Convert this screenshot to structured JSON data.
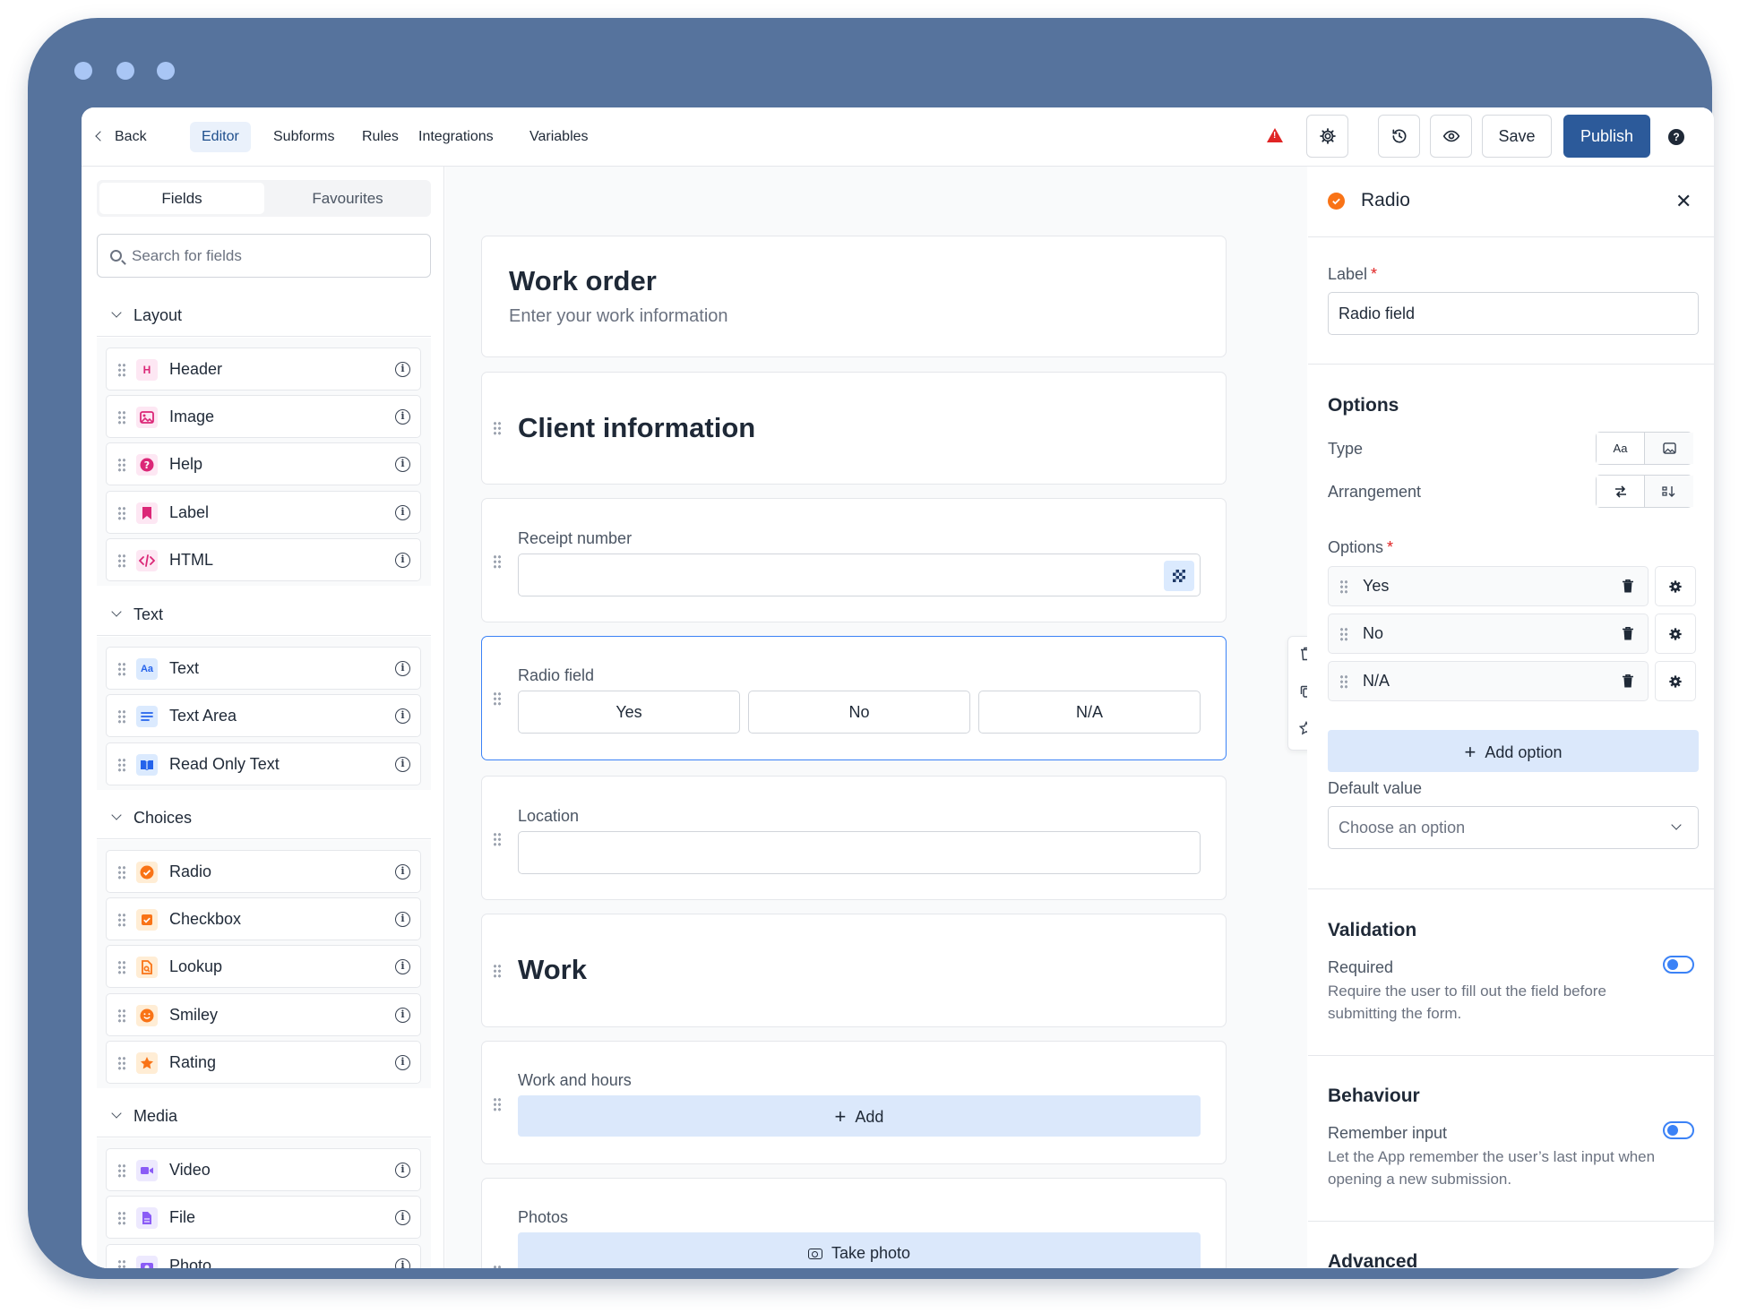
{
  "topbar": {
    "back": "Back",
    "tabs": [
      "Editor",
      "Subforms",
      "Rules",
      "Integrations",
      "Variables"
    ],
    "save": "Save",
    "publish": "Publish",
    "icons": [
      "warning-icon",
      "gear-icon",
      "history-icon",
      "eye-icon",
      "help-icon"
    ],
    "accent_color": "#2c5a9a",
    "warning_color": "#e02424"
  },
  "left": {
    "tabs": [
      "Fields",
      "Favourites"
    ],
    "search_placeholder": "Search for fields",
    "groups": [
      {
        "label": "Layout",
        "items": [
          "Header",
          "Image",
          "Help",
          "Label",
          "HTML"
        ]
      },
      {
        "label": "Text",
        "items": [
          "Text",
          "Text Area",
          "Read Only Text"
        ]
      },
      {
        "label": "Choices",
        "items": [
          "Radio",
          "Checkbox",
          "Lookup",
          "Smiley",
          "Rating"
        ]
      },
      {
        "label": "Media",
        "items": [
          "Video",
          "File",
          "Photo"
        ]
      }
    ],
    "icon_glyphs": {
      "header": "H",
      "text": "Aa"
    }
  },
  "canvas": {
    "form_title": "Work order",
    "form_subtitle": "Enter your work information",
    "section_client": "Client information",
    "receipt_label": "Receipt number",
    "radio_label": "Radio field",
    "radio_options": [
      "Yes",
      "No",
      "N/A"
    ],
    "location_label": "Location",
    "section_work": "Work",
    "work_hours_label": "Work and hours",
    "add_label": "Add",
    "photos_label": "Photos",
    "take_photo_label": "Take photo"
  },
  "panel": {
    "title": "Radio",
    "close_glyph": "✕",
    "label_field_label": "Label",
    "label_value": "Radio field",
    "options_heading": "Options",
    "type_label": "Type",
    "type_text_glyph": "Aa",
    "arrangement_label": "Arrangement",
    "options_list_label": "Options",
    "options": [
      "Yes",
      "No",
      "N/A"
    ],
    "add_option": "Add option",
    "default_value_label": "Default value",
    "default_value_placeholder": "Choose an option",
    "validation_heading": "Validation",
    "required_label": "Required",
    "required_desc": "Require the user to fill out the field before submitting the form.",
    "behaviour_heading": "Behaviour",
    "remember_label": "Remember input",
    "remember_desc": "Let the App remember the user’s last input when opening a new submission.",
    "advanced_heading": "Advanced"
  }
}
